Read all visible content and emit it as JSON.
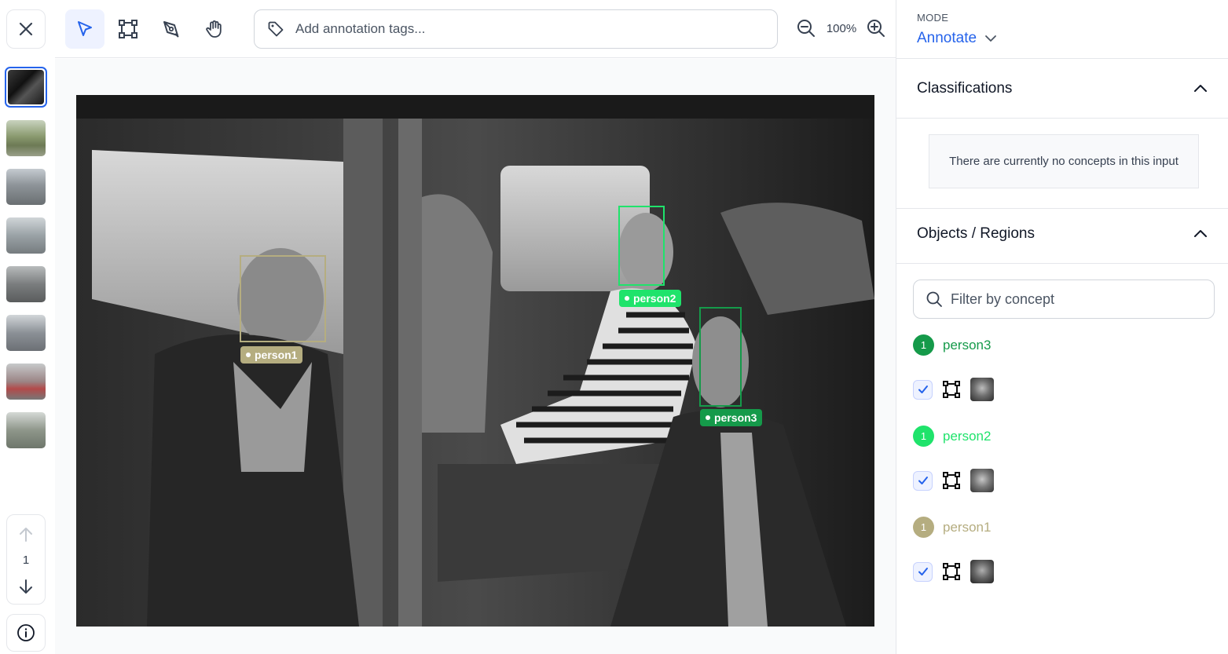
{
  "toolbar": {
    "tags_placeholder": "Add annotation tags...",
    "zoom_level": "100%",
    "tools": [
      "select-tool",
      "bounding-box-tool",
      "polygon-tool",
      "pan-tool"
    ],
    "active_tool": "select-tool"
  },
  "navigation": {
    "page_number": "1",
    "thumbnails": [
      {
        "name": "thumbnail-1",
        "tone": "#1f1f1f",
        "active": true
      },
      {
        "name": "thumbnail-2",
        "tone": "#8a9a6f",
        "active": false
      },
      {
        "name": "thumbnail-3",
        "tone": "#8e9499",
        "active": false
      },
      {
        "name": "thumbnail-4",
        "tone": "#9aa2a6",
        "active": false
      },
      {
        "name": "thumbnail-5",
        "tone": "#7a7d7e",
        "active": false
      },
      {
        "name": "thumbnail-6",
        "tone": "#8b9096",
        "active": false
      },
      {
        "name": "thumbnail-7",
        "tone": "#9b8585",
        "active": false
      },
      {
        "name": "thumbnail-8",
        "tone": "#8e968a",
        "active": false
      }
    ]
  },
  "annotations": {
    "person1": {
      "label": "person1",
      "color": "#b5ad80"
    },
    "person2": {
      "label": "person2",
      "color": "#1fe36b"
    },
    "person3": {
      "label": "person3",
      "color": "#159a4a"
    }
  },
  "panel": {
    "mode_label": "MODE",
    "mode_value": "Annotate",
    "classifications_title": "Classifications",
    "classifications_empty": "There are currently no concepts in this input",
    "objects_title": "Objects / Regions",
    "filter_placeholder": "Filter by concept",
    "concepts": [
      {
        "name": "person3",
        "count": "1",
        "color": "#159a4a"
      },
      {
        "name": "person2",
        "count": "1",
        "color": "#1fe36b"
      },
      {
        "name": "person1",
        "count": "1",
        "color": "#b5ad80"
      }
    ]
  },
  "colors": {
    "accent": "#2563eb",
    "border": "#e5e7eb"
  }
}
